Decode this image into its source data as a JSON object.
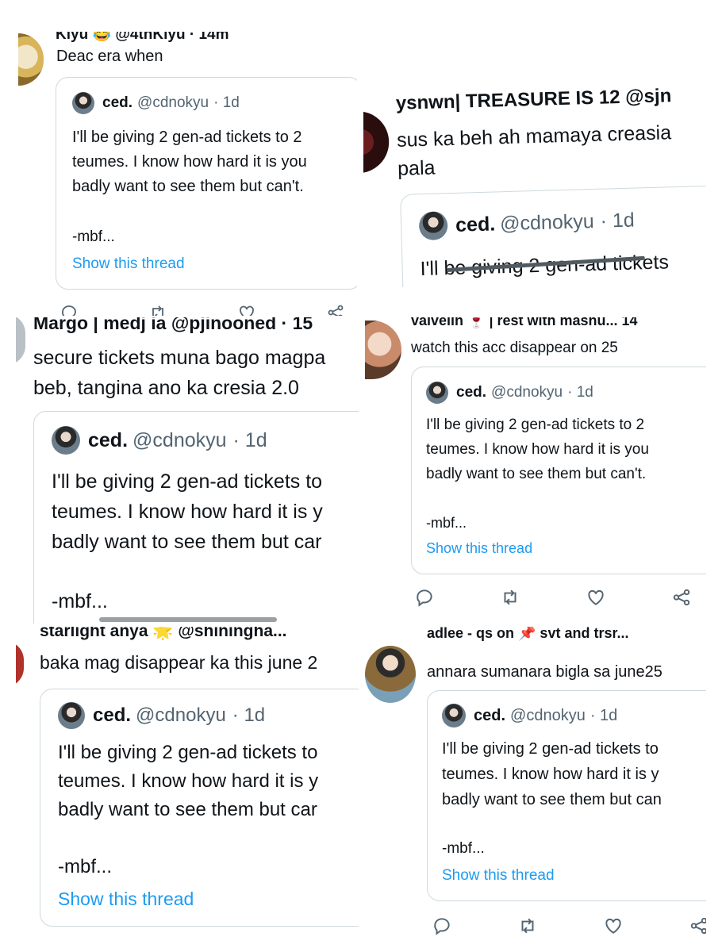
{
  "quoted_tweet": {
    "name": "ced.",
    "handle": "@cdnokyu",
    "time": "· 1d",
    "line1": "I'll be giving 2 gen-ad tickets to 2",
    "line2": "teumes. I know how hard it is you",
    "line3": "badly want to see them but can't.",
    "signoff": "-mbf...",
    "show_thread": "Show this thread"
  },
  "panels": {
    "p1": {
      "header": "Kiyu 😂 @4thKiyu · 14m",
      "text": "Deac era when"
    },
    "p2": {
      "header": "ysnwn| TREASURE IS 12 @sjn",
      "text_line1": "sus ka beh ah mamaya creasia",
      "text_line2": "pala",
      "quote_partial": "I'll be giving 2 gen-ad tickets"
    },
    "p3": {
      "header": "Margo | medj ia @pjinooned · 15",
      "text_line1": "secure tickets muna bago magpa",
      "text_line2": "beb, tangina ano ka cresia 2.0",
      "quote_line1": "I'll be giving 2 gen-ad tickets to",
      "quote_line2": "teumes. I know how hard it is y",
      "quote_line3": "badly want to see them but car"
    },
    "p4": {
      "header": "valvelin 🍷 | rest with mashu...   14",
      "text": "watch this acc disappear on 25"
    },
    "p5": {
      "header": "starlight anya 🌟 @shiningha...",
      "text": "baka mag disappear ka this june 2",
      "quote_line1": "I'll be giving 2 gen-ad tickets to",
      "quote_line2": "teumes. I know how hard it is y",
      "quote_line3": "badly want to see them but car"
    },
    "p6": {
      "header": "adlee - qs on 📌 svt and trsr...",
      "text": "annara sumanara bigla sa june25",
      "quote_line1": "I'll be giving 2 gen-ad tickets to",
      "quote_line2": "teumes. I know how hard it is y",
      "quote_line3": "badly want to see them but can"
    }
  },
  "colors": {
    "link": "#1d9bf0",
    "secondary": "#536471",
    "border": "#cfd9de"
  }
}
